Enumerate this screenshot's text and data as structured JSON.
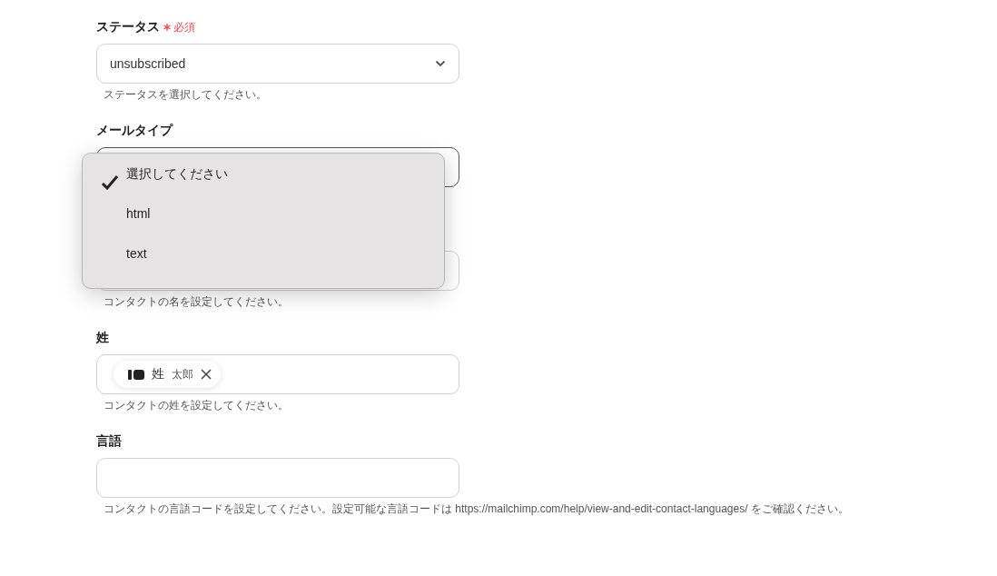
{
  "fields": [
    {
      "label": "ステータス",
      "required": true,
      "required_text": "必須",
      "kind": "select",
      "value": "unsubscribed",
      "help": "ステータスを選択してください。"
    },
    {
      "label": "メールタイプ",
      "required": false,
      "kind": "select"
    },
    {
      "kind": "chips",
      "help": "コンタクトの名を設定してください。"
    },
    {
      "label": "姓",
      "required": false,
      "kind": "chips",
      "chips": [
        {
          "name": "姓",
          "value": "太郎"
        }
      ],
      "help": "コンタクトの姓を設定してください。"
    },
    {
      "label": "言語",
      "required": false,
      "kind": "text",
      "help": "コンタクトの言語コードを設定してください。設定可能な言語コードは https://mailchimp.com/help/view-and-edit-contact-languages/ をご確認ください。"
    }
  ],
  "dropdown": {
    "options": [
      {
        "label": "選択してください",
        "selected": true
      },
      {
        "label": "html",
        "selected": false
      },
      {
        "label": "text",
        "selected": false
      }
    ]
  }
}
